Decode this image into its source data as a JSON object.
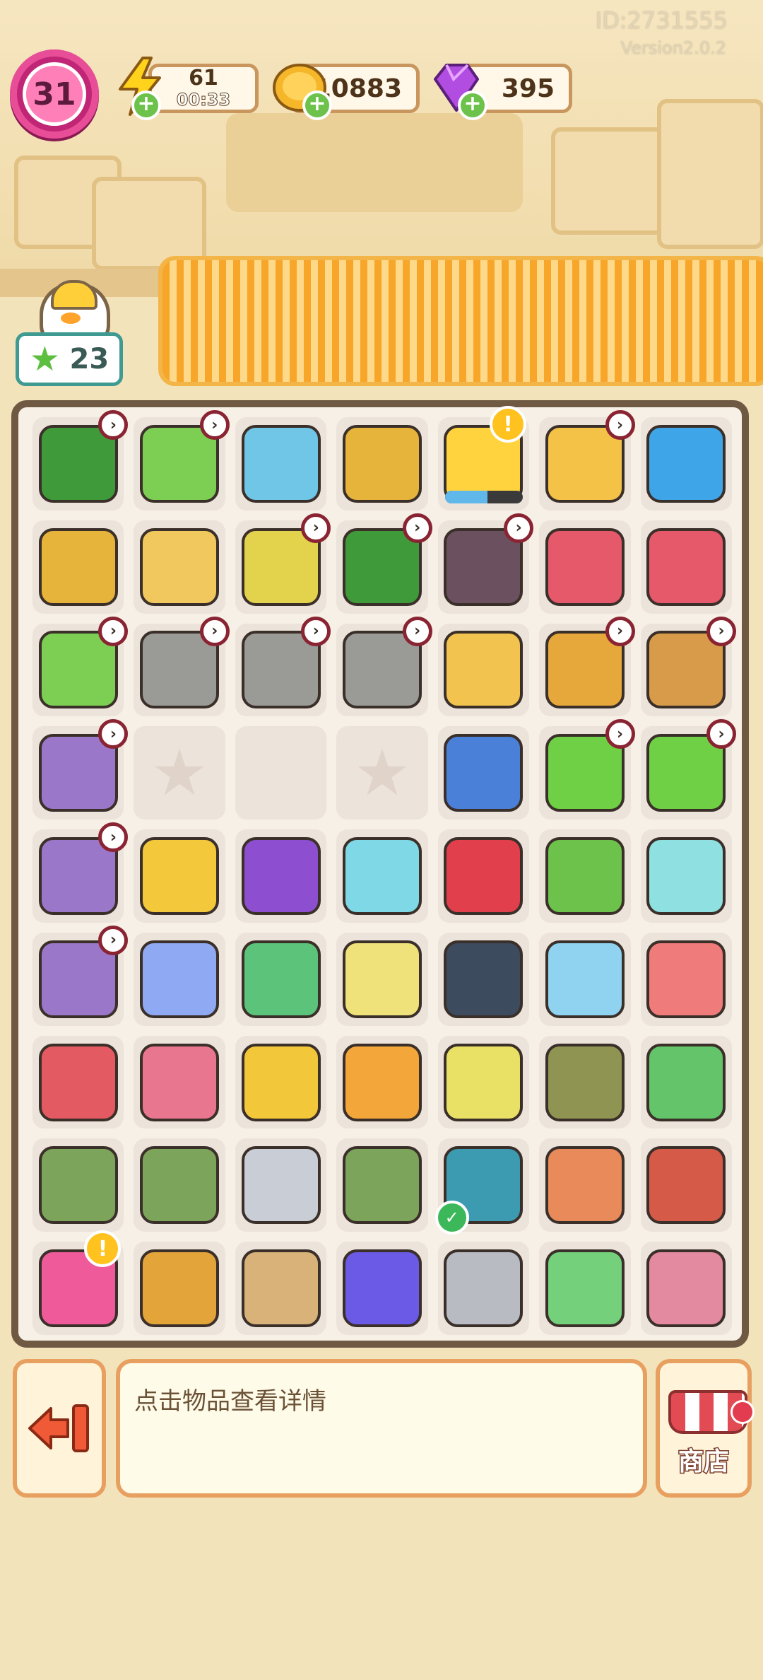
{
  "header": {
    "id_text": "ID:2731555",
    "version_text": "Version2.0.2",
    "level": "31",
    "energy": {
      "value": "61",
      "timer": "00:33"
    },
    "coins": {
      "value": "10883"
    },
    "gems": {
      "value": "395"
    },
    "stars": "23"
  },
  "colors": {
    "board_border": "#6f5943",
    "accent_orange": "#f7a62a",
    "level_pink": "#c02675",
    "plus_green": "#6cc24a"
  },
  "inventory": {
    "rows": [
      [
        {
          "icon": "toolbox-icon",
          "color": "#3f9b3a",
          "badge": true
        },
        {
          "icon": "laptop-icon",
          "color": "#7ccf53",
          "badge": true
        },
        {
          "icon": "printer-icon",
          "color": "#6fc6e6"
        },
        {
          "icon": "locker-icon",
          "color": "#e6b43a"
        },
        {
          "icon": "duck-float-icon",
          "color": "#ffd33d",
          "alert": true,
          "progress": 0.55
        },
        {
          "icon": "shopping-cart-duck-icon",
          "color": "#f3c247",
          "badge": true
        },
        {
          "icon": "robot-vacuum-icon",
          "color": "#3ea6e8"
        }
      ],
      [
        {
          "icon": "locker-icon",
          "color": "#e6b43a"
        },
        {
          "icon": "bucket-icon",
          "color": "#f1c85e"
        },
        {
          "icon": "cart-icon",
          "color": "#e3d24c",
          "badge": true
        },
        {
          "icon": "cash-register-icon",
          "color": "#3f9b3a",
          "badge": true
        },
        {
          "icon": "tv-camera-icon",
          "color": "#6b5160",
          "badge": true
        },
        {
          "icon": "tool-bucket-icon",
          "color": "#e6596a"
        },
        {
          "icon": "wheelbarrow-icon",
          "color": "#e6596a"
        }
      ],
      [
        {
          "icon": "laptop-icon",
          "color": "#7ccf53",
          "badge": true
        },
        {
          "icon": "sack-icon",
          "color": "#9a9a96",
          "badge": true
        },
        {
          "icon": "sack-icon",
          "color": "#9a9a96",
          "badge": true
        },
        {
          "icon": "sack-icon",
          "color": "#9a9a96",
          "badge": true
        },
        {
          "icon": "plant-pot-icon",
          "color": "#f2c34f"
        },
        {
          "icon": "cabinet-icon",
          "color": "#e6a83a",
          "badge": true
        },
        {
          "icon": "basket-icon",
          "color": "#d89b4a",
          "badge": true
        }
      ],
      [
        {
          "icon": "clothes-pile-icon",
          "color": "#9b77c9",
          "badge": true
        },
        {
          "icon": "empty-star-icon",
          "empty": true
        },
        {
          "icon": "empty-cell",
          "empty": true,
          "blank": true
        },
        {
          "icon": "empty-star-icon",
          "empty": true
        },
        {
          "icon": "shoehorn-icon",
          "color": "#4a80d8"
        },
        {
          "icon": "flower-tree-icon",
          "color": "#6fcf45",
          "badge": true
        },
        {
          "icon": "flower-tree-icon",
          "color": "#6fcf45",
          "badge": true
        }
      ],
      [
        {
          "icon": "clothes-pile-icon",
          "color": "#9b77c9",
          "badge": true
        },
        {
          "icon": "medal-rosette-icon",
          "color": "#f3c83a"
        },
        {
          "icon": "clothes-bin-icon",
          "color": "#8d4fd0"
        },
        {
          "icon": "dumbbell-icon",
          "color": "#7fd8e6"
        },
        {
          "icon": "medal-ribbon-icon",
          "color": "#e03f4b"
        },
        {
          "icon": "potted-plant-icon",
          "color": "#6cc24a"
        },
        {
          "icon": "helmet-icon",
          "color": "#8fe0e0"
        }
      ],
      [
        {
          "icon": "clothes-pile-icon",
          "color": "#9b77c9",
          "badge": true
        },
        {
          "icon": "pillow-icon",
          "color": "#8fa9f2"
        },
        {
          "icon": "banknotes-icon",
          "color": "#5bc47a"
        },
        {
          "icon": "frame-icon",
          "color": "#f0e27a"
        },
        {
          "icon": "ab-roller-icon",
          "color": "#3c4b5e"
        },
        {
          "icon": "sneakers-icon",
          "color": "#8fd3f0"
        },
        {
          "icon": "snail-icon",
          "color": "#f07b7b"
        }
      ],
      [
        {
          "icon": "vr-headset-icon",
          "color": "#e45a62"
        },
        {
          "icon": "bricks-icon",
          "color": "#e9768f"
        },
        {
          "icon": "gold-medal-icon",
          "color": "#f2c83a"
        },
        {
          "icon": "jersey-icon",
          "color": "#f3a63a"
        },
        {
          "icon": "basket-tray-icon",
          "color": "#e9e166"
        },
        {
          "icon": "sandbags-icon",
          "color": "#8f9452"
        },
        {
          "icon": "money-stack-icon",
          "color": "#63c46a"
        }
      ],
      [
        {
          "icon": "gloves-icon",
          "color": "#7ca55b"
        },
        {
          "icon": "gloves-icon",
          "color": "#7ca55b"
        },
        {
          "icon": "barbell-icon",
          "color": "#c9ced6"
        },
        {
          "icon": "gloves-icon",
          "color": "#7ca55b"
        },
        {
          "icon": "tiles-icon",
          "color": "#3c9bb0",
          "check": true
        },
        {
          "icon": "hammer-icon",
          "color": "#e88a5a"
        },
        {
          "icon": "shop-building-icon",
          "color": "#d65a48"
        }
      ],
      [
        {
          "icon": "backpack-icon",
          "color": "#ef5a9a",
          "alert": true
        },
        {
          "icon": "fries-box-icon",
          "color": "#e3a43a"
        },
        {
          "icon": "parcel-icon",
          "color": "#d9b27a"
        },
        {
          "icon": "game-console-icon",
          "color": "#6a5ae6"
        },
        {
          "icon": "spring-icon",
          "color": "#b8bcc2"
        },
        {
          "icon": "basketball-machine-icon",
          "color": "#74d07a"
        },
        {
          "icon": "brick-pallet-icon",
          "color": "#e48aa0"
        }
      ]
    ]
  },
  "footer": {
    "info_text": "点击物品查看详情",
    "shop_label": "商店"
  }
}
